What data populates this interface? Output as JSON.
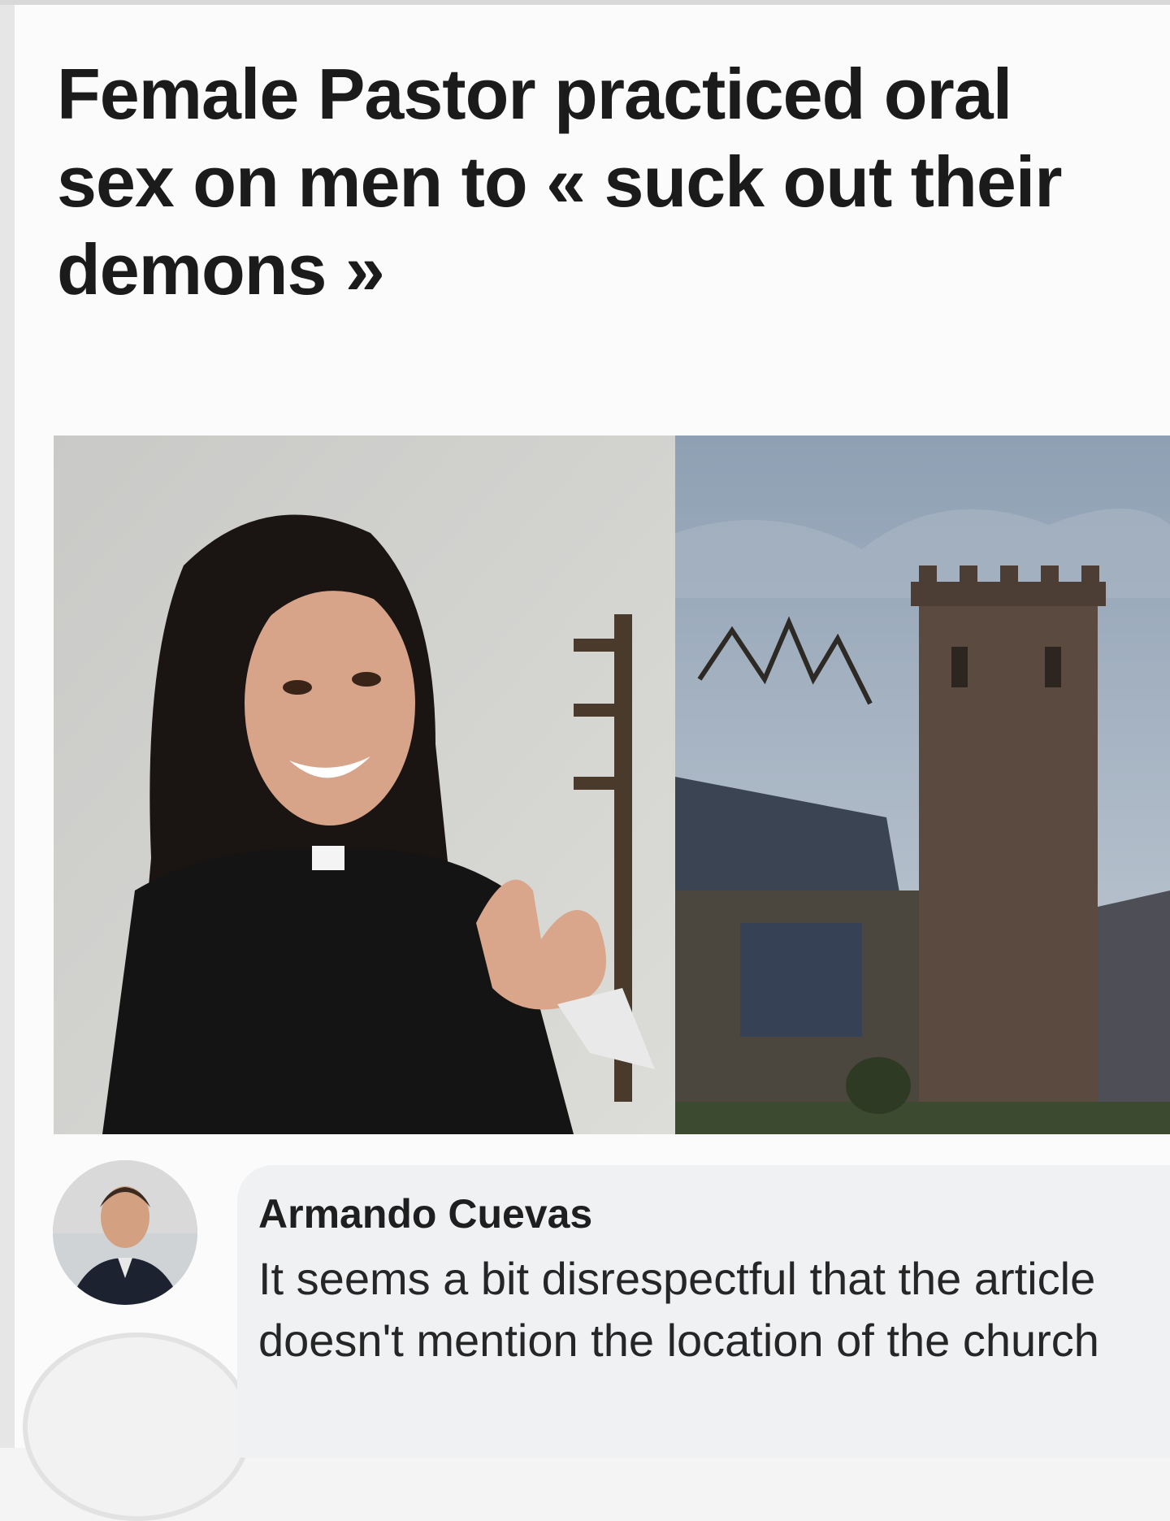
{
  "post": {
    "headline": "Female Pastor practiced oral sex on men to « suck out their demons »"
  },
  "image": {
    "left_photo": "woman-pastor-photo",
    "right_photo": "church-tower-photo"
  },
  "comment": {
    "author": "Armando Cuevas",
    "text": "It seems a bit disrespectful that the article doesn't mention the location of the church"
  }
}
